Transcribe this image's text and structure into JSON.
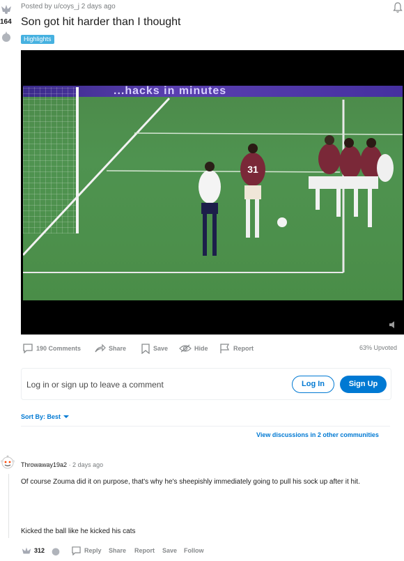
{
  "post": {
    "meta": "Posted by u/coys_j 2 days ago",
    "title": "Son got hit harder than I thought",
    "flair": "Highlights",
    "score": "164",
    "video_ad_text": "...hacks in minutes"
  },
  "actions": {
    "comments": "190 Comments",
    "share": "Share",
    "save": "Save",
    "hide": "Hide",
    "report": "Report",
    "upvoted": "63% Upvoted"
  },
  "login": {
    "prompt": "Log in or sign up to leave a comment",
    "login_label": "Log In",
    "signup_label": "Sign Up"
  },
  "sort": {
    "label": "Sort By: Best"
  },
  "view_discussions": "View discussions in 2 other communities",
  "comment": {
    "author": "Throwaway19a2",
    "time": "· 2 days ago",
    "body1": "Of course Zouma did it on purpose, that's why he's sheepishly immediately going to pull his sock up after it hit.",
    "body2": "Kicked the ball like he kicked his cats",
    "score": "312",
    "reply": "Reply",
    "share": "Share",
    "report": "Report",
    "save": "Save",
    "follow": "Follow"
  },
  "colors": {
    "accent": "#0079d3",
    "flair": "#46b1e0",
    "muted": "#878a8c"
  }
}
